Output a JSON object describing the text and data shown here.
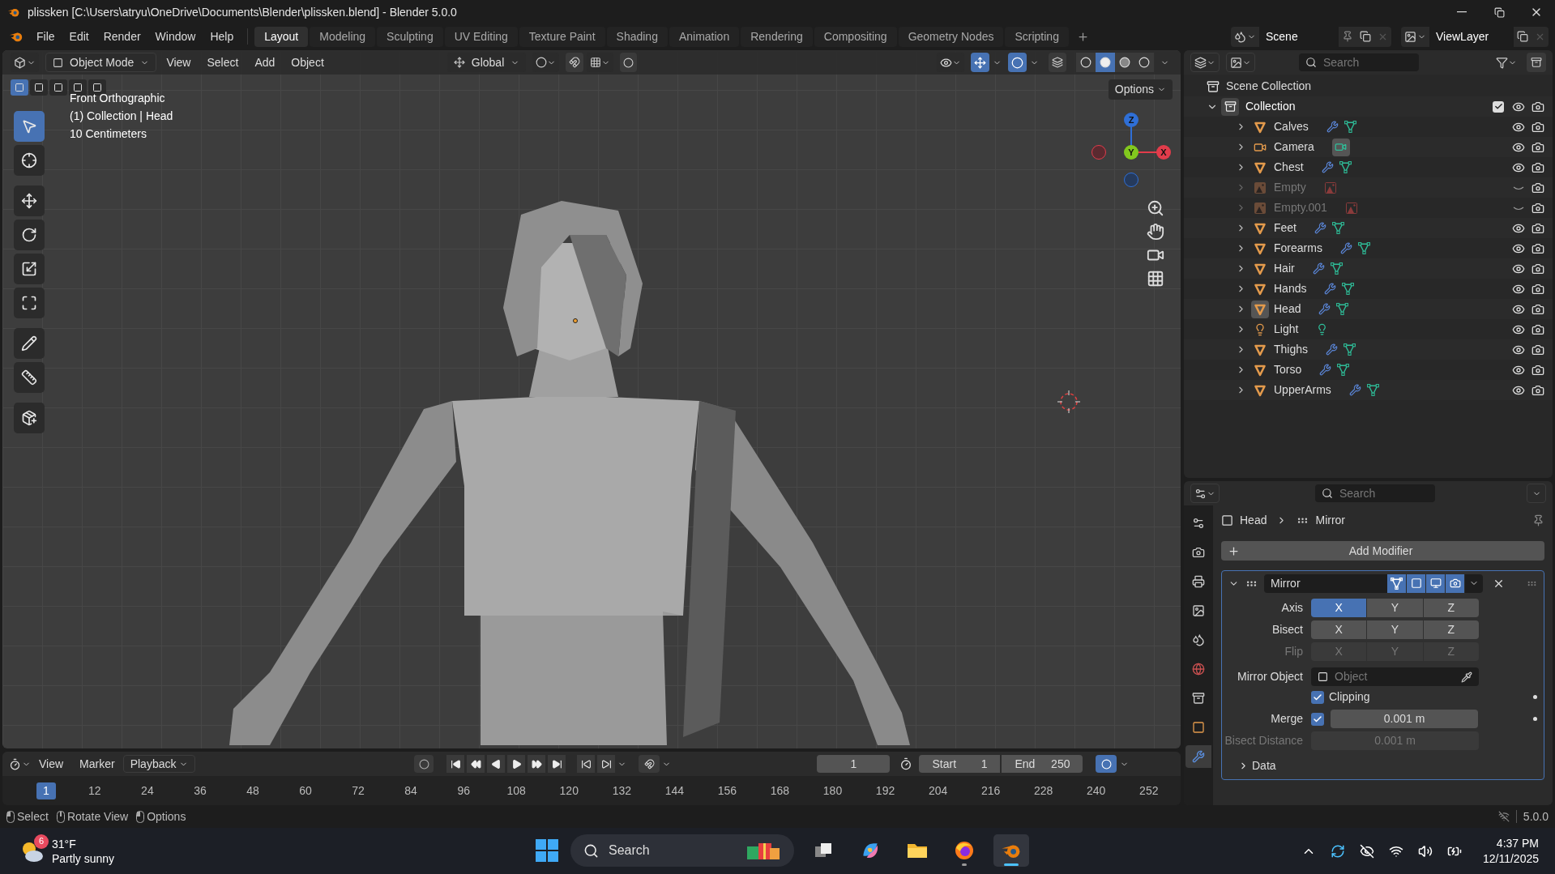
{
  "window": {
    "title": "plissken [C:\\Users\\atryu\\OneDrive\\Documents\\Blender\\plissken.blend] - Blender 5.0.0"
  },
  "menu": [
    "File",
    "Edit",
    "Render",
    "Window",
    "Help"
  ],
  "workspaces": [
    {
      "label": "Layout",
      "selected": true
    },
    {
      "label": "Modeling",
      "selected": false
    },
    {
      "label": "Sculpting",
      "selected": false
    },
    {
      "label": "UV Editing",
      "selected": false
    },
    {
      "label": "Texture Paint",
      "selected": false
    },
    {
      "label": "Shading",
      "selected": false
    },
    {
      "label": "Animation",
      "selected": false
    },
    {
      "label": "Rendering",
      "selected": false
    },
    {
      "label": "Compositing",
      "selected": false
    },
    {
      "label": "Geometry Nodes",
      "selected": false
    },
    {
      "label": "Scripting",
      "selected": false
    }
  ],
  "scene": "Scene",
  "view_layer": "ViewLayer",
  "viewport": {
    "mode": "Object Mode",
    "menus": [
      "View",
      "Select",
      "Add",
      "Object"
    ],
    "orientation": "Global",
    "options": "Options",
    "overlay_lines": [
      "Front Orthographic",
      "(1) Collection | Head",
      "10 Centimeters"
    ],
    "select_modes": [
      {
        "selected": true
      },
      {
        "selected": false
      },
      {
        "selected": false
      },
      {
        "selected": false
      },
      {
        "selected": false
      }
    ],
    "tools": [
      {
        "kind": "select",
        "selected": true
      },
      {
        "kind": "cursor",
        "selected": false
      },
      {
        "kind": "move",
        "selected": false
      },
      {
        "kind": "rotate",
        "selected": false
      },
      {
        "kind": "scale",
        "selected": false
      },
      {
        "kind": "transform",
        "selected": false
      },
      {
        "kind": "annotate",
        "selected": false
      },
      {
        "kind": "measure",
        "selected": false
      },
      {
        "kind": "add_cube",
        "selected": false
      }
    ],
    "shading": [
      {
        "kind": "wireframe",
        "selected": false
      },
      {
        "kind": "solid",
        "selected": true
      },
      {
        "kind": "material",
        "selected": false
      },
      {
        "kind": "rendered",
        "selected": false
      }
    ],
    "gizmo_axes": [
      {
        "label": "Z",
        "color": "#2f6fd6"
      },
      {
        "label": "Y",
        "color": "#82c81e"
      },
      {
        "label": "X",
        "color": "#e23c4b"
      }
    ]
  },
  "outliner": {
    "search_placeholder": "Search",
    "root": "Scene Collection",
    "collection": {
      "label": "Collection",
      "expanded": true,
      "checked": true,
      "children": [
        {
          "name": "Calves",
          "kind": "mesh",
          "visible": true,
          "active": false
        },
        {
          "name": "Camera",
          "kind": "camera",
          "visible": true,
          "active": false
        },
        {
          "name": "Chest",
          "kind": "mesh",
          "visible": true,
          "active": false
        },
        {
          "name": "Empty",
          "kind": "empty",
          "visible": false,
          "active": false
        },
        {
          "name": "Empty.001",
          "kind": "empty",
          "visible": false,
          "active": false
        },
        {
          "name": "Feet",
          "kind": "mesh",
          "visible": true,
          "active": false
        },
        {
          "name": "Forearms",
          "kind": "mesh",
          "visible": true,
          "active": false
        },
        {
          "name": "Hair",
          "kind": "mesh",
          "visible": true,
          "active": false
        },
        {
          "name": "Hands",
          "kind": "mesh",
          "visible": true,
          "active": false
        },
        {
          "name": "Head",
          "kind": "mesh",
          "visible": true,
          "active": true
        },
        {
          "name": "Light",
          "kind": "light",
          "visible": true,
          "active": false
        },
        {
          "name": "Thighs",
          "kind": "mesh",
          "visible": true,
          "active": false
        },
        {
          "name": "Torso",
          "kind": "mesh",
          "visible": true,
          "active": false
        },
        {
          "name": "UpperArms",
          "kind": "mesh",
          "visible": true,
          "active": false
        }
      ]
    }
  },
  "properties": {
    "search_placeholder": "Search",
    "tabs": [
      {
        "kind": "tool",
        "selected": false
      },
      {
        "kind": "render",
        "selected": false
      },
      {
        "kind": "output",
        "selected": false
      },
      {
        "kind": "view_layer",
        "selected": false
      },
      {
        "kind": "scene",
        "selected": false
      },
      {
        "kind": "world",
        "selected": false
      },
      {
        "kind": "collection",
        "selected": false
      },
      {
        "kind": "object",
        "selected": false
      },
      {
        "kind": "modifiers",
        "selected": true
      }
    ],
    "breadcrumb": [
      "Head",
      "Mirror"
    ],
    "add_modifier": "Add Modifier",
    "modifier": {
      "name": "Mirror",
      "expanded": true,
      "toggles": [
        {
          "kind": "edit_mode",
          "on": true
        },
        {
          "kind": "cage",
          "on": true
        },
        {
          "kind": "viewport",
          "on": true
        },
        {
          "kind": "render",
          "on": true
        }
      ],
      "rows": [
        {
          "label": "Axis",
          "disabled": false,
          "options": [
            {
              "label": "X",
              "selected": true
            },
            {
              "label": "Y",
              "selected": false
            },
            {
              "label": "Z",
              "selected": false
            }
          ]
        },
        {
          "label": "Bisect",
          "disabled": false,
          "options": [
            {
              "label": "X",
              "selected": false
            },
            {
              "label": "Y",
              "selected": false
            },
            {
              "label": "Z",
              "selected": false
            }
          ]
        },
        {
          "label": "Flip",
          "disabled": true,
          "options": [
            {
              "label": "X",
              "selected": false
            },
            {
              "label": "Y",
              "selected": false
            },
            {
              "label": "Z",
              "selected": false
            }
          ]
        }
      ],
      "mirror_object": {
        "label": "Mirror Object",
        "placeholder": "Object"
      },
      "clipping": {
        "label": "Clipping",
        "checked": true
      },
      "merge": {
        "label": "Merge",
        "checked": true,
        "value": "0.001 m"
      },
      "bisect_distance": {
        "label": "Bisect Distance",
        "value": "0.001 m",
        "disabled": true
      },
      "data_section": {
        "label": "Data",
        "expanded": false
      }
    }
  },
  "timeline": {
    "menus": [
      "View",
      "Marker"
    ],
    "playback": "Playback",
    "current_frame": "1",
    "start_label": "Start",
    "start": "1",
    "end_label": "End",
    "end": "250",
    "ruler": [
      {
        "label": "1",
        "selected": true
      },
      {
        "label": "12",
        "selected": false
      },
      {
        "label": "24",
        "selected": false
      },
      {
        "label": "36",
        "selected": false
      },
      {
        "label": "48",
        "selected": false
      },
      {
        "label": "60",
        "selected": false
      },
      {
        "label": "72",
        "selected": false
      },
      {
        "label": "84",
        "selected": false
      },
      {
        "label": "96",
        "selected": false
      },
      {
        "label": "108",
        "selected": false
      },
      {
        "label": "120",
        "selected": false
      },
      {
        "label": "132",
        "selected": false
      },
      {
        "label": "144",
        "selected": false
      },
      {
        "label": "156",
        "selected": false
      },
      {
        "label": "168",
        "selected": false
      },
      {
        "label": "180",
        "selected": false
      },
      {
        "label": "192",
        "selected": false
      },
      {
        "label": "204",
        "selected": false
      },
      {
        "label": "216",
        "selected": false
      },
      {
        "label": "228",
        "selected": false
      },
      {
        "label": "240",
        "selected": false
      },
      {
        "label": "252",
        "selected": false
      }
    ]
  },
  "status_bar": {
    "hints": [
      "Select",
      "Rotate View",
      "Options"
    ],
    "version": "5.0.0"
  },
  "taskbar": {
    "weather": {
      "badge": "6",
      "temperature": "31°F",
      "condition": "Partly sunny"
    },
    "search_placeholder": "Search",
    "apps": [
      {
        "kind": "taskview",
        "open": false,
        "selected": false
      },
      {
        "kind": "copilot",
        "open": false,
        "selected": false
      },
      {
        "kind": "explorer",
        "open": false,
        "selected": false
      },
      {
        "kind": "firefox",
        "open": true,
        "selected": false
      },
      {
        "kind": "blender",
        "open": true,
        "selected": true
      }
    ],
    "time": "4:37 PM",
    "date": "12/11/2025"
  }
}
